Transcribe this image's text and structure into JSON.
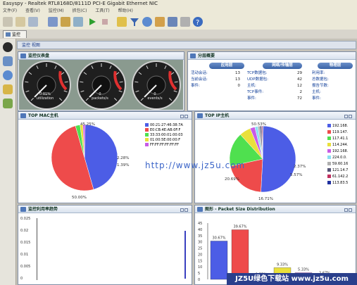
{
  "window": {
    "title": "Easyspy - Realtek RTL8168D/8111D PCI-E Gigabit Ethernet NIC",
    "menu": [
      "文件(F)",
      "查看(V)",
      "监控(M)",
      "抓包(C)",
      "工具(T)",
      "帮助(H)"
    ]
  },
  "tabs": {
    "main": "监控"
  },
  "subtab": {
    "label": "监控 视图"
  },
  "panels": {
    "gauges": {
      "title": "监控仪表盘"
    },
    "layers": {
      "title": "分层概要"
    },
    "mac": {
      "title": "TOP MAC主机"
    },
    "ip": {
      "title": "TOP IP主机"
    },
    "util": {
      "title": "监控利用率趋势"
    },
    "pkt": {
      "title": "图形 - Packet Size Distribution"
    }
  },
  "gauges": [
    {
      "value": "0.01%",
      "unit": "utilization"
    },
    {
      "value": "0",
      "unit": "packets/s"
    },
    {
      "value": "0",
      "unit": "events/s"
    }
  ],
  "layers": {
    "app": {
      "header": "应用层",
      "rows": [
        {
          "label": "活动会话:",
          "value": "13"
        },
        {
          "label": "当前会话:",
          "value": "13"
        },
        {
          "label": "事件:",
          "value": "0"
        }
      ]
    },
    "net": {
      "header": "网络/传输层",
      "rows": [
        {
          "label": "TCP数据包:",
          "value": "29"
        },
        {
          "label": "UDP数据包:",
          "value": "42"
        },
        {
          "label": "主机:",
          "value": "12"
        },
        {
          "label": "TCP事件:",
          "value": "2"
        },
        {
          "label": "事件:",
          "value": "72"
        }
      ]
    },
    "phy": {
      "header": "物理层",
      "rows": [
        {
          "label": "利用率:"
        },
        {
          "label": "总数据包:"
        },
        {
          "label": "报告节数:"
        },
        {
          "label": "主机:"
        },
        {
          "label": "事件:"
        }
      ]
    }
  },
  "mac_legend": [
    "00:21:27:46:38:7A",
    "E0:CB:4E:AB:0F:F",
    "33:33:00:01:00:03",
    "01:00:5E:00:00:F",
    "FF:FF:FF:FF:FF:FF"
  ],
  "ip_legend": [
    "192.168.",
    "119.147.",
    "117.41.1",
    "114.244.",
    "192.168.",
    "224.0.0.",
    "59.60.16",
    "121.14.7",
    "61.142.2",
    "113.83.5"
  ],
  "util_ticks": [
    "0.025",
    "0.02",
    "0.015",
    "0.01",
    "0.005",
    "0"
  ],
  "pkt_ticks": [
    "45",
    "40",
    "35",
    "30",
    "25",
    "20",
    "15",
    "10",
    "5",
    "0"
  ],
  "watermark": "http://www.jz5u.com",
  "banner": "JZ5U绿色下载站 www.jz5u.com",
  "chart_data": [
    {
      "type": "pie",
      "title": "TOP MAC主机",
      "labels": [
        "00:21:27:46:38:7A",
        "E0:CB:4E:AB:0F:F",
        "33:33:00:01:00:03",
        "01:00:5E:00:00:F",
        "FF:FF:FF:FF:FF:FF"
      ],
      "values": [
        45.25,
        50.0,
        2.28,
        1.39,
        1.08
      ],
      "shown_labels": [
        "45.25%",
        "50.00%",
        "2.28%",
        "1.39%"
      ],
      "colors": [
        "#4c5de6",
        "#ee4b4b",
        "#4fe04f",
        "#e9e03b",
        "#c85be6"
      ]
    },
    {
      "type": "pie",
      "title": "TOP IP主机",
      "labels": [
        "192.168.",
        "119.147.",
        "117.41.1",
        "114.244.",
        "192.168.",
        "224.0.0.",
        "59.60.16",
        "121.14.7",
        "61.142.2",
        "113.83.5"
      ],
      "values": [
        50.53,
        20.69,
        16.71,
        5.57,
        2.37,
        1.5,
        1.0,
        0.8,
        0.5,
        0.33
      ],
      "shown_labels": [
        "50.53%",
        "20.69%",
        "16.71%",
        "5.57%",
        "2.37%"
      ],
      "colors": [
        "#4c5de6",
        "#ee4b4b",
        "#4fe04f",
        "#e9e03b",
        "#c85be6",
        "#8ae0f2",
        "#b0b0b0",
        "#555577",
        "#c03060",
        "#2030a0"
      ]
    },
    {
      "type": "bar",
      "title": "图形 - Packet Size Distribution",
      "values": [
        30.67,
        39.67,
        1.33,
        9.33,
        5.33,
        2.67,
        0.0
      ],
      "shown_labels": [
        "30.67%",
        "39.67%",
        "1.33%",
        "9.33%",
        "5.33%",
        "2.67%",
        "0.00%"
      ],
      "colors": [
        "#4c5de6",
        "#ee4b4b",
        "#4fe04f",
        "#e9e03b",
        "#c85be6",
        "#8ae0f2",
        "#b0b0b0"
      ],
      "ylim": [
        0,
        45
      ]
    }
  ]
}
